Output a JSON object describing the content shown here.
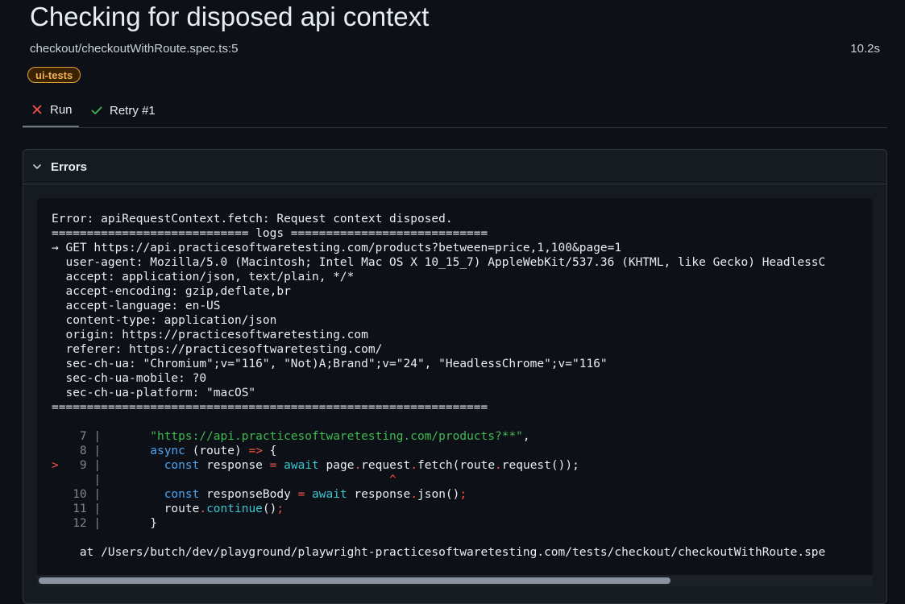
{
  "header": {
    "title": "Checking for disposed api context",
    "file": "checkout/checkoutWithRoute.spec.ts:5",
    "duration": "10.2s",
    "tag": "ui-tests"
  },
  "tabs": [
    {
      "label": "Run",
      "icon": "x-icon",
      "status": "failed",
      "color": "#f85149"
    },
    {
      "label": "Retry #1",
      "icon": "check-icon",
      "status": "passed",
      "color": "#3fb950"
    }
  ],
  "errors": {
    "section_label": "Errors",
    "lines": [
      "Error: apiRequestContext.fetch: Request context disposed.",
      "============================ logs ============================",
      "→ GET https://api.practicesoftwaretesting.com/products?between=price,1,100&page=1",
      "  user-agent: Mozilla/5.0 (Macintosh; Intel Mac OS X 10_15_7) AppleWebKit/537.36 (KHTML, like Gecko) HeadlessC",
      "  accept: application/json, text/plain, */*",
      "  accept-encoding: gzip,deflate,br",
      "  accept-language: en-US",
      "  content-type: application/json",
      "  origin: https://practicesoftwaretesting.com",
      "  referer: https://practicesoftwaretesting.com/",
      "  sec-ch-ua: \"Chromium\";v=\"116\", \"Not)A;Brand\";v=\"24\", \"HeadlessChrome\";v=\"116\"",
      "  sec-ch-ua-mobile: ?0",
      "  sec-ch-ua-platform: \"macOS\"",
      "=============================================================="
    ],
    "snippet": [
      {
        "marker": " ",
        "num": "7",
        "parts": [
          [
            "      ",
            ""
          ],
          [
            "\"https://api.practicesoftwaretesting.com/products?**\"",
            "green"
          ],
          [
            ",",
            ""
          ]
        ]
      },
      {
        "marker": " ",
        "num": "8",
        "parts": [
          [
            "      ",
            ""
          ],
          [
            "async",
            "blue"
          ],
          [
            " (route) ",
            ""
          ],
          [
            "=>",
            "red"
          ],
          [
            " {",
            ""
          ]
        ]
      },
      {
        "marker": ">",
        "num": "9",
        "parts": [
          [
            "        ",
            ""
          ],
          [
            "const",
            "blue"
          ],
          [
            " response ",
            ""
          ],
          [
            "=",
            "red"
          ],
          [
            " ",
            ""
          ],
          [
            "await",
            "cyan"
          ],
          [
            " page",
            ""
          ],
          [
            ".",
            "red"
          ],
          [
            "request",
            ""
          ],
          [
            ".",
            "red"
          ],
          [
            "fetch(route",
            ""
          ],
          [
            ".",
            "red"
          ],
          [
            "request());",
            ""
          ]
        ]
      },
      {
        "marker": " ",
        "num": "",
        "parts": [
          [
            "                                        ",
            ""
          ],
          [
            "^",
            "red"
          ]
        ]
      },
      {
        "marker": " ",
        "num": "10",
        "parts": [
          [
            "        ",
            ""
          ],
          [
            "const",
            "blue"
          ],
          [
            " responseBody ",
            ""
          ],
          [
            "=",
            "red"
          ],
          [
            " ",
            ""
          ],
          [
            "await",
            "cyan"
          ],
          [
            " response",
            ""
          ],
          [
            ".",
            "red"
          ],
          [
            "json()",
            ""
          ],
          [
            ";",
            "red"
          ]
        ]
      },
      {
        "marker": " ",
        "num": "11",
        "parts": [
          [
            "        route",
            ""
          ],
          [
            ".",
            "red"
          ],
          [
            "continue",
            "cyan"
          ],
          [
            "()",
            ""
          ],
          [
            ";",
            "red"
          ]
        ]
      },
      {
        "marker": " ",
        "num": "12",
        "parts": [
          [
            "      }",
            ""
          ]
        ]
      }
    ],
    "stack": "    at /Users/butch/dev/playground/playwright-practicesoftwaretesting.com/tests/checkout/checkoutWithRoute.spe"
  }
}
